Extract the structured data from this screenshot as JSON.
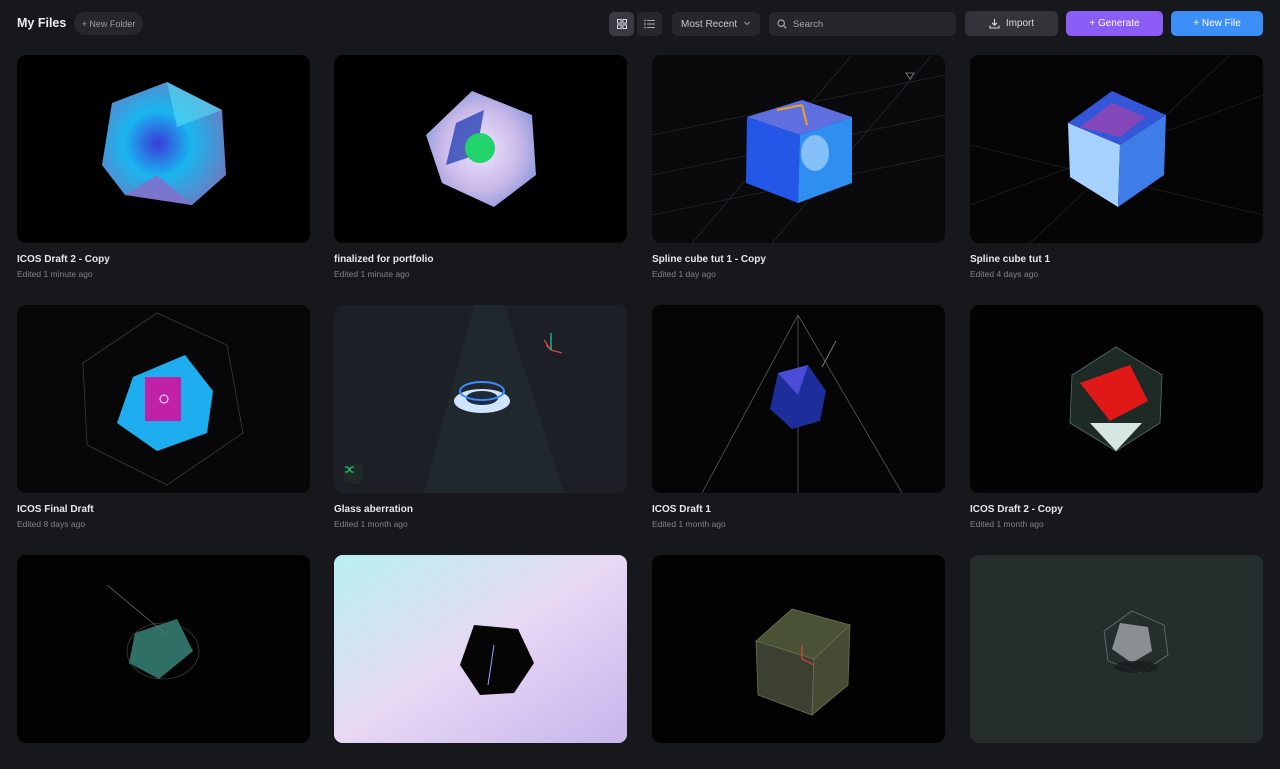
{
  "header": {
    "title": "My Files",
    "new_folder_label": "+ New Folder",
    "view_modes": [
      "grid-icon",
      "list-icon"
    ],
    "active_view": "grid",
    "sort_label": "Most Recent",
    "search_placeholder": "Search",
    "import_label": "Import",
    "generate_label": "+ Generate",
    "new_file_label": "+ New File"
  },
  "colors": {
    "background": "#17181c",
    "generate": "#8b5cf6",
    "new_file": "#3b8ff6",
    "control": "#25272d"
  },
  "files": [
    {
      "name": "ICOS Draft 2 - Copy",
      "edited": "Edited 1 minute ago"
    },
    {
      "name": "finalized for portfolio",
      "edited": "Edited 1 minute ago"
    },
    {
      "name": "Spline cube tut 1 - Copy",
      "edited": "Edited 1 day ago"
    },
    {
      "name": "Spline cube tut 1",
      "edited": "Edited 4 days ago"
    },
    {
      "name": "ICOS Final Draft",
      "edited": "Edited 8 days ago"
    },
    {
      "name": "Glass aberration",
      "edited": "Edited 1 month ago"
    },
    {
      "name": "ICOS Draft 1",
      "edited": "Edited 1 month ago"
    },
    {
      "name": "ICOS Draft 2 - Copy",
      "edited": "Edited 1 month ago"
    },
    {
      "name": "",
      "edited": ""
    },
    {
      "name": "",
      "edited": ""
    },
    {
      "name": "",
      "edited": ""
    },
    {
      "name": "",
      "edited": ""
    }
  ]
}
